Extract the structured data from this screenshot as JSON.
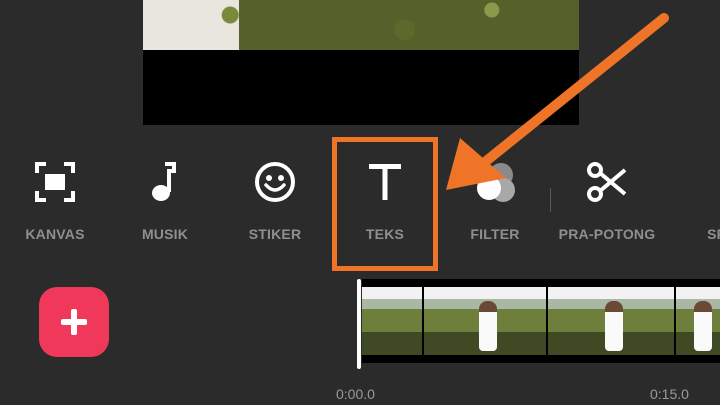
{
  "tools": [
    {
      "name": "kanvas",
      "label": "KANVAS",
      "icon": "canvas-crop-icon"
    },
    {
      "name": "musik",
      "label": "MUSIK",
      "icon": "music-note-icon"
    },
    {
      "name": "stiker",
      "label": "STIKER",
      "icon": "smiley-icon"
    },
    {
      "name": "teks",
      "label": "TEKS",
      "icon": "text-icon"
    },
    {
      "name": "filter",
      "label": "FILTER",
      "icon": "filter-circles-icon"
    },
    {
      "name": "pra-potong",
      "label": "PRA-POTONG",
      "icon": "scissors-icon"
    },
    {
      "name": "split",
      "label": "SPL",
      "icon": "split-icon"
    }
  ],
  "timeline": {
    "start_time": "0:00.0",
    "end_time": "0:15.0"
  },
  "colors": {
    "background": "#2b2b2b",
    "highlight": "#f07427",
    "add_button": "#f0395a",
    "label": "#8f8f8f"
  }
}
